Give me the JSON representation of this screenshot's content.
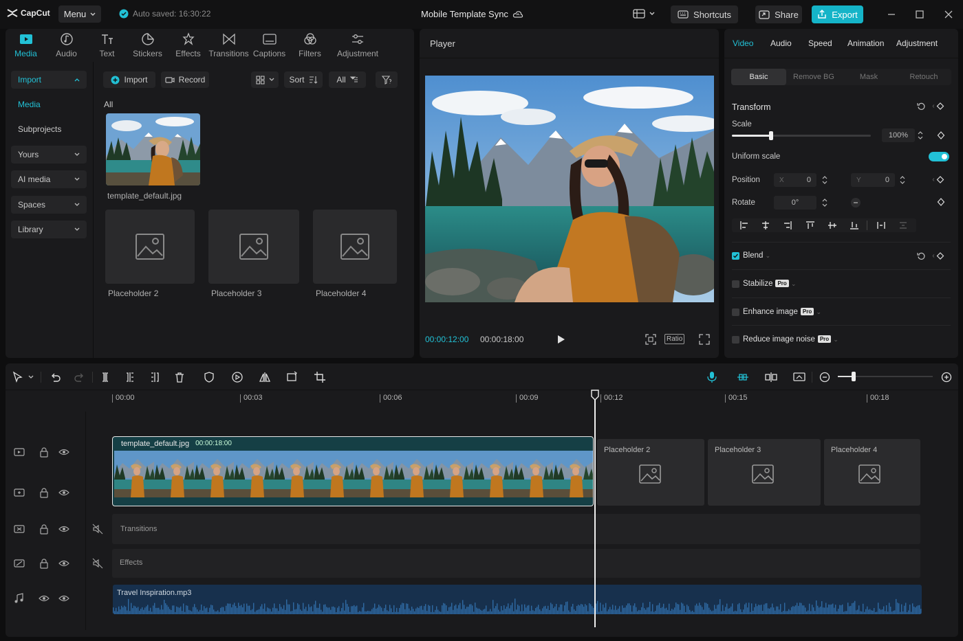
{
  "app": {
    "logo_text": "CapCut",
    "menu_label": "Menu",
    "autosave": "Auto saved: 16:30:22",
    "project_title": "Mobile Template Sync",
    "shortcuts_label": "Shortcuts",
    "share_label": "Share",
    "export_label": "Export"
  },
  "media_tabs": [
    {
      "label": "Media",
      "icon": "media-icon",
      "active": true
    },
    {
      "label": "Audio",
      "icon": "audio-icon"
    },
    {
      "label": "Text",
      "icon": "text-icon"
    },
    {
      "label": "Stickers",
      "icon": "stickers-icon"
    },
    {
      "label": "Effects",
      "icon": "effects-icon"
    },
    {
      "label": "Transitions",
      "icon": "transitions-icon"
    },
    {
      "label": "Captions",
      "icon": "captions-icon"
    },
    {
      "label": "Filters",
      "icon": "filters-icon"
    },
    {
      "label": "Adjustment",
      "icon": "adjustment-icon"
    }
  ],
  "sidebar": {
    "items": [
      {
        "label": "Import"
      },
      {
        "label": "Media"
      },
      {
        "label": "Subprojects"
      },
      {
        "label": "Yours"
      },
      {
        "label": "AI media"
      },
      {
        "label": "Spaces"
      },
      {
        "label": "Library"
      }
    ]
  },
  "media_toolbar": {
    "import_label": "Import",
    "record_label": "Record",
    "sort_label": "Sort",
    "filter_all": "All"
  },
  "media_grid": {
    "section_label": "All",
    "items": [
      {
        "label": "template_default.jpg"
      },
      {
        "label": "Placeholder 2"
      },
      {
        "label": "Placeholder 3"
      },
      {
        "label": "Placeholder 4"
      }
    ]
  },
  "player": {
    "title": "Player",
    "current_time": "00:00:12:00",
    "total_time": "00:00:18:00",
    "ratio_label": "Ratio"
  },
  "properties": {
    "tabs": [
      "Video",
      "Audio",
      "Speed",
      "Animation",
      "Adjustment"
    ],
    "subtabs": [
      "Basic",
      "Remove BG",
      "Mask",
      "Retouch"
    ],
    "transform_label": "Transform",
    "scale_label": "Scale",
    "scale_value": "100%",
    "scale_fraction": 0.28,
    "uniform_scale_label": "Uniform scale",
    "position_label": "Position",
    "pos_x_label": "X",
    "pos_x": "0",
    "pos_y_label": "Y",
    "pos_y": "0",
    "rotate_label": "Rotate",
    "rotate_value": "0°",
    "blend_label": "Blend",
    "stabilize_label": "Stabilize",
    "enhance_label": "Enhance image",
    "noise_label": "Reduce image noise",
    "pro_badge": "Pro"
  },
  "timeline": {
    "ruler": [
      "00:00",
      "00:03",
      "00:06",
      "00:09",
      "00:12",
      "00:15",
      "00:18"
    ],
    "main_clip_name": "template_default.jpg",
    "main_clip_duration": "00:00:18:00",
    "placeholders": [
      "Placeholder 2",
      "Placeholder 3",
      "Placeholder 4"
    ],
    "transitions_label": "Transitions",
    "effects_label": "Effects",
    "audio_clip_name": "Travel Inspiration.mp3",
    "zoom_fraction": 0.17
  },
  "colors": {
    "accent": "#22c1d6",
    "export": "#15b4c8",
    "audio_track": "#1b3a5c"
  }
}
